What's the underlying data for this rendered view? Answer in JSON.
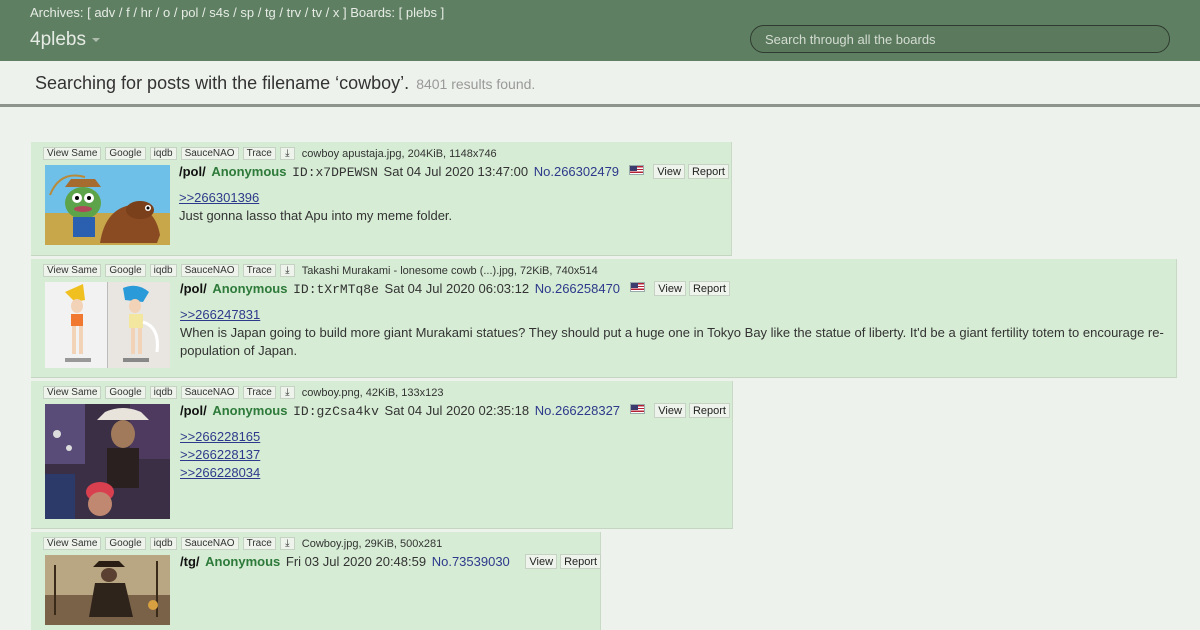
{
  "topbar": {
    "archives_label": "Archives: [",
    "archives": [
      "adv",
      "f",
      "hr",
      "o",
      "pol",
      "s4s",
      "sp",
      "tg",
      "trv",
      "tv",
      "x"
    ],
    "boards_label": "] Boards: [",
    "boards": [
      "plebs"
    ],
    "close": "]",
    "brand": "4plebs",
    "search_placeholder": "Search through all the boards"
  },
  "results": {
    "title": "Searching for posts with the filename ‘cowboy’.",
    "count": "8401 results found."
  },
  "tools": {
    "view_same": "View Same",
    "google": "Google",
    "iqdb": "iqdb",
    "saucenao": "SauceNAO",
    "trace": "Trace",
    "download_icon": "⤓"
  },
  "post_buttons": {
    "view": "View",
    "report": "Report"
  },
  "posts": [
    {
      "file": "cowboy apustaja.jpg, 204KiB, 1148x746",
      "board": "/pol/",
      "name": "Anonymous",
      "uid": "ID:x7DPEWSN",
      "date": "Sat 04 Jul 2020 13:47:00",
      "no": "No.266302479",
      "flag": true,
      "quotes": [
        ">>266301396"
      ],
      "text": "Just gonna lasso that Apu into my meme folder."
    },
    {
      "file": "Takashi Murakami - lonesome cowb (...).jpg, 72KiB, 740x514",
      "board": "/pol/",
      "name": "Anonymous",
      "uid": "ID:tXrMTq8e",
      "date": "Sat 04 Jul 2020 06:03:12",
      "no": "No.266258470",
      "flag": true,
      "quotes": [
        ">>266247831"
      ],
      "text": "When is Japan going to build more giant Murakami statues? They should put a huge one in Tokyo Bay like the statue of liberty. It'd be a giant fertility totem to encourage re-population of Japan."
    },
    {
      "file": "cowboy.png, 42KiB, 133x123",
      "board": "/pol/",
      "name": "Anonymous",
      "uid": "ID:gzCsa4kv",
      "date": "Sat 04 Jul 2020 02:35:18",
      "no": "No.266228327",
      "flag": true,
      "quotes": [
        ">>266228165",
        ">>266228137",
        ">>266228034"
      ],
      "text": ""
    },
    {
      "file": "Cowboy.jpg, 29KiB, 500x281",
      "board": "/tg/",
      "name": "Anonymous",
      "uid": "",
      "date": "Fri 03 Jul 2020 20:48:59",
      "no": "No.73539030",
      "flag": false,
      "quotes": [],
      "text": ""
    }
  ]
}
